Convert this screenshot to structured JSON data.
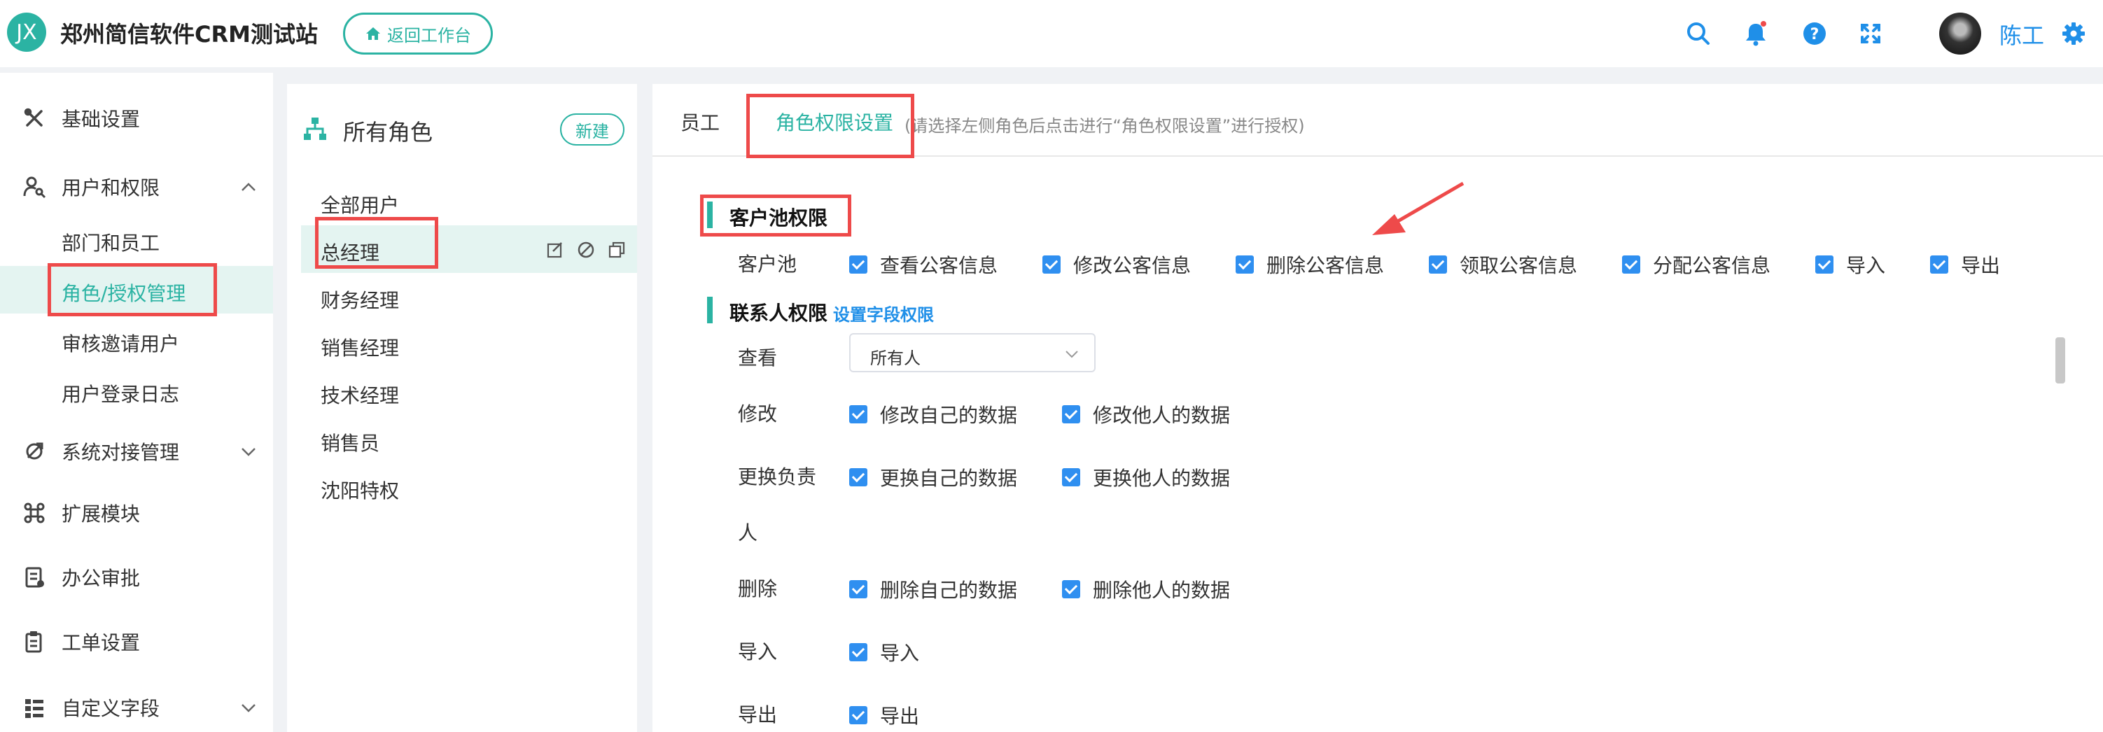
{
  "header": {
    "logo_text": "JX",
    "app_title": "郑州简信软件CRM测试站",
    "back_button": "返回工作台",
    "user_name": "陈工",
    "icons": [
      "search-icon",
      "bell-icon",
      "help-icon",
      "fullscreen-icon",
      "gear-icon"
    ],
    "accent_color": "#2bb3a3",
    "link_color": "#1f8fe8"
  },
  "sidebar": {
    "items": [
      {
        "label": "基础设置",
        "icon": "tools-icon"
      },
      {
        "label": "用户和权限",
        "icon": "user-key-icon",
        "expanded": true,
        "children": [
          "部门和员工",
          "角色/授权管理",
          "审核邀请用户",
          "用户登录日志"
        ],
        "active_child": "角色/授权管理"
      },
      {
        "label": "系统对接管理",
        "icon": "connect-icon",
        "expanded": false
      },
      {
        "label": "扩展模块",
        "icon": "command-icon"
      },
      {
        "label": "办公审批",
        "icon": "approval-icon"
      },
      {
        "label": "工单设置",
        "icon": "clipboard-icon"
      },
      {
        "label": "自定义字段",
        "icon": "fields-icon",
        "expanded": false
      }
    ]
  },
  "roles": {
    "title": "所有角色",
    "new_button": "新建",
    "items": [
      "全部用户",
      "总经理",
      "财务经理",
      "销售经理",
      "技术经理",
      "销售员",
      "沈阳特权"
    ],
    "active": "总经理"
  },
  "main": {
    "tabs": [
      {
        "label": "员工"
      },
      {
        "label": "角色权限设置",
        "active": true
      }
    ],
    "tab_hint": "(请选择左侧角色后点击进行“角色权限设置”进行授权)",
    "sections": {
      "customer_pool": {
        "title": "客户池权限",
        "row_label": "客户池",
        "options": [
          "查看公客信息",
          "修改公客信息",
          "删除公客信息",
          "领取公客信息",
          "分配公客信息",
          "导入",
          "导出"
        ]
      },
      "contacts": {
        "title": "联系人权限",
        "field_link": "设置字段权限",
        "view_label": "查看",
        "view_value": "所有人",
        "rows": [
          {
            "label": "修改",
            "options": [
              "修改自己的数据",
              "修改他人的数据"
            ]
          },
          {
            "label_line1": "更换负责",
            "label_line2": "人",
            "options": [
              "更换自己的数据",
              "更换他人的数据"
            ]
          },
          {
            "label": "删除",
            "options": [
              "删除自己的数据",
              "删除他人的数据"
            ]
          },
          {
            "label": "导入",
            "options": [
              "导入"
            ]
          },
          {
            "label": "导出",
            "options": [
              "导出"
            ]
          }
        ]
      }
    }
  }
}
